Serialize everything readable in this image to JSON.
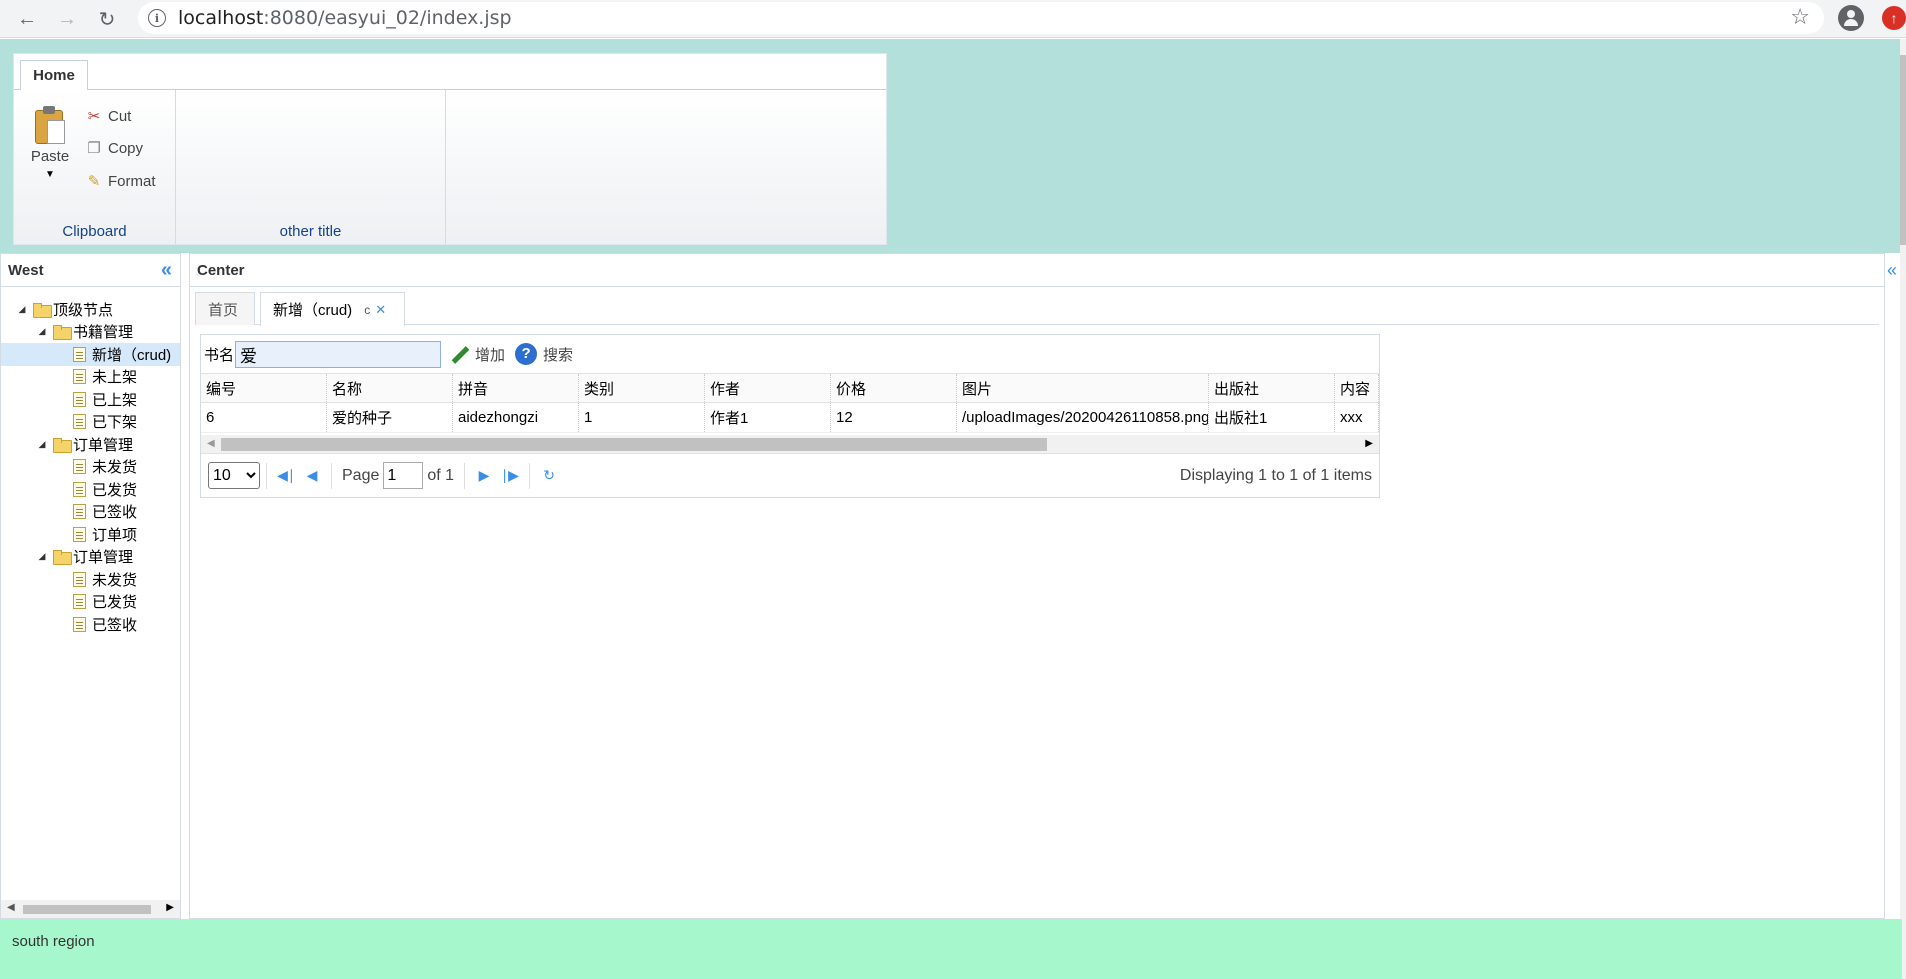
{
  "browser": {
    "url_host": "localhost",
    "url_rest": ":8080/easyui_02/index.jsp"
  },
  "ribbon": {
    "tab": "Home",
    "paste": "Paste",
    "cut": "Cut",
    "copy": "Copy",
    "format": "Format",
    "group1": "Clipboard",
    "group2": "other title"
  },
  "west": {
    "title": "West",
    "tree": [
      {
        "label": "顶级节点",
        "level": 0,
        "type": "folder"
      },
      {
        "label": "书籍管理",
        "level": 1,
        "type": "folder"
      },
      {
        "label": "新增（crud)",
        "level": 2,
        "type": "file",
        "selected": true
      },
      {
        "label": "未上架",
        "level": 2,
        "type": "file"
      },
      {
        "label": "已上架",
        "level": 2,
        "type": "file"
      },
      {
        "label": "已下架",
        "level": 2,
        "type": "file"
      },
      {
        "label": "订单管理",
        "level": 1,
        "type": "folder"
      },
      {
        "label": "未发货",
        "level": 2,
        "type": "file"
      },
      {
        "label": "已发货",
        "level": 2,
        "type": "file"
      },
      {
        "label": "已签收",
        "level": 2,
        "type": "file"
      },
      {
        "label": "订单项",
        "level": 2,
        "type": "file"
      },
      {
        "label": "订单管理",
        "level": 1,
        "type": "folder"
      },
      {
        "label": "未发货",
        "level": 2,
        "type": "file"
      },
      {
        "label": "已发货",
        "level": 2,
        "type": "file"
      },
      {
        "label": "已签收",
        "level": 2,
        "type": "file"
      }
    ]
  },
  "center": {
    "title": "Center",
    "tabs": [
      "首页",
      "新增（crud)"
    ]
  },
  "grid": {
    "search_label": "书名",
    "search_value": "爱",
    "add_label": "增加",
    "search_button": "搜索",
    "columns": [
      "编号",
      "名称",
      "拼音",
      "类别",
      "作者",
      "价格",
      "图片",
      "出版社",
      "内容"
    ],
    "rows": [
      [
        "6",
        "爱的种子",
        "aidezhongzi",
        "1",
        "作者1",
        "12",
        "/uploadImages/20200426110858.png",
        "出版社1",
        "xxx"
      ]
    ],
    "page_size": "10",
    "page_label": "Page",
    "page_value": "1",
    "of_label": "of 1",
    "info": "Displaying 1 to 1 of 1 items"
  },
  "south": {
    "text": "south region"
  }
}
